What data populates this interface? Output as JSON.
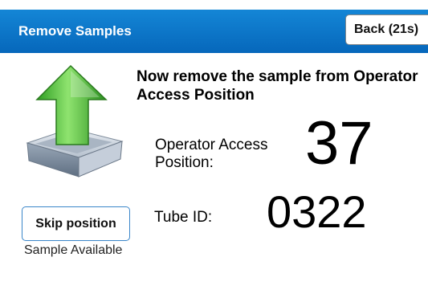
{
  "header": {
    "title": "Remove Samples",
    "back_label": "Back (21s)",
    "bg_color": "#0a74c9"
  },
  "icon": {
    "name": "tray-up-arrow-icon",
    "arrow_color": "#3fbf2f"
  },
  "main": {
    "instruction": "Now remove the sample from Operator Access Position",
    "position_label": "Operator Access Position:",
    "position_value": "37",
    "tube_label": "Tube ID:",
    "tube_value": "0322"
  },
  "actions": {
    "skip_label": "Skip position",
    "status_text": "Sample Available"
  }
}
